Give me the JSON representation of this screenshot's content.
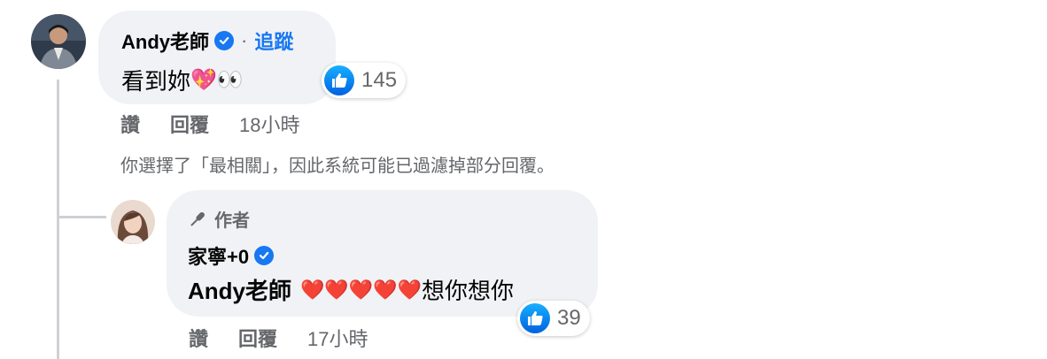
{
  "comment": {
    "author": "Andy老師",
    "separator": "·",
    "follow_label": "追蹤",
    "text": "看到妳",
    "emoji": "💖👀",
    "reaction_count": "145",
    "actions": {
      "like": "讚",
      "reply": "回覆",
      "time": "18小時"
    }
  },
  "filter_notice": "你選擇了「最相關」，因此系統可能已過濾掉部分回覆。",
  "reply": {
    "badge_label": "作者",
    "author": "家寧+0",
    "mention": "Andy老師",
    "hearts": "❤️❤️❤️❤️❤️",
    "text": "想你想你",
    "reaction_count": "39",
    "actions": {
      "like": "讚",
      "reply": "回覆",
      "time": "17小時"
    }
  },
  "colors": {
    "accent": "#1877f2",
    "bubble": "#f0f2f5",
    "secondary_text": "#65676b",
    "thread_line": "#ced0d4"
  }
}
